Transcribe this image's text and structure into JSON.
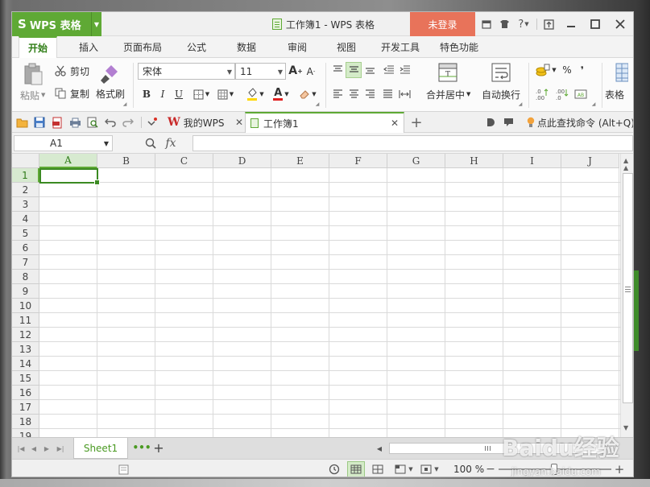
{
  "titlebar": {
    "app_label": "WPS 表格",
    "title": "工作簿1 - WPS 表格",
    "login_label": "未登录",
    "help_icon": "?"
  },
  "menu": {
    "tabs": [
      "开始",
      "插入",
      "页面布局",
      "公式",
      "数据",
      "审阅",
      "视图",
      "开发工具",
      "特色功能"
    ]
  },
  "ribbon": {
    "paste": "粘贴",
    "cut": "剪切",
    "copy": "复制",
    "format_painter": "格式刷",
    "font_name": "宋体",
    "font_size": "11",
    "bold": "B",
    "italic": "I",
    "underline": "U",
    "font_color_letter": "A",
    "merge_center": "合并居中",
    "wrap_text": "自动换行",
    "percent": "%",
    "comma": "❜",
    "dec_inc": "+.0\n.00",
    "dec_dec": ".00\n+.0",
    "table_style": "表格"
  },
  "quickbar": {
    "tab_mywps": "我的WPS",
    "tab_workbook": "工作簿1",
    "search_command": "点此查找命令 (Alt+Q)"
  },
  "formula_bar": {
    "name_box": "A1",
    "fx": "fx"
  },
  "grid": {
    "columns": [
      "A",
      "B",
      "C",
      "D",
      "E",
      "F",
      "G",
      "H",
      "I",
      "J"
    ],
    "rows": [
      "1",
      "2",
      "3",
      "4",
      "5",
      "6",
      "7",
      "8",
      "9",
      "10",
      "11",
      "12",
      "13",
      "14",
      "15",
      "16",
      "17",
      "18",
      "19"
    ]
  },
  "sheetbar": {
    "sheet_tab": "Sheet1"
  },
  "statusbar": {
    "zoom": "100 %"
  },
  "watermark": {
    "text": "Baidu经验",
    "sub": "jingyan.baidu.com"
  },
  "colors": {
    "accent": "#5fa935",
    "login": "#e8735a"
  }
}
